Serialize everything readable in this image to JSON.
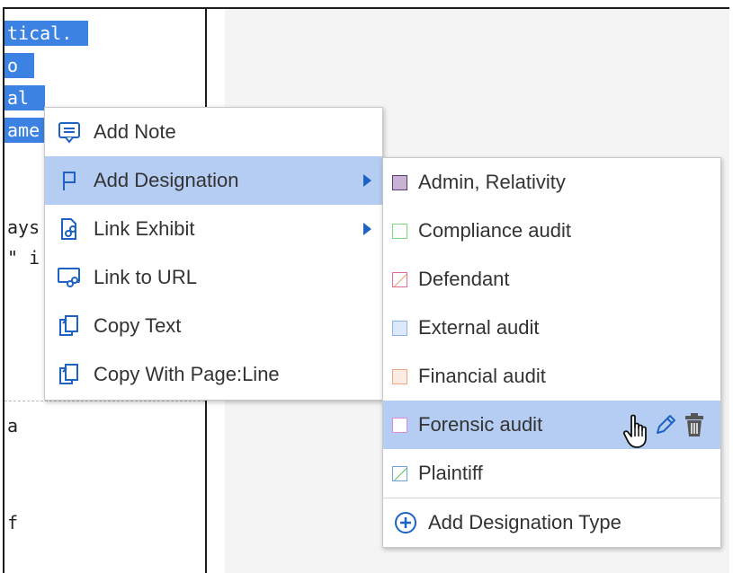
{
  "document": {
    "highlighted_lines": [
      "tical.",
      "o",
      "al",
      "ame"
    ],
    "plain_lines": [
      "ays",
      "\" i",
      "a",
      "f"
    ]
  },
  "context_menu": {
    "items": [
      {
        "label": "Add Note",
        "icon": "note-icon",
        "has_submenu": false,
        "active": false
      },
      {
        "label": "Add Designation",
        "icon": "flag-icon",
        "has_submenu": true,
        "active": true
      },
      {
        "label": "Link Exhibit",
        "icon": "link-exhibit-icon",
        "has_submenu": true,
        "active": false
      },
      {
        "label": "Link to URL",
        "icon": "link-url-icon",
        "has_submenu": false,
        "active": false
      },
      {
        "label": "Copy Text",
        "icon": "copy-icon",
        "has_submenu": false,
        "active": false
      },
      {
        "label": "Copy With Page:Line",
        "icon": "copy-icon",
        "has_submenu": false,
        "active": false
      }
    ]
  },
  "designation_submenu": {
    "items": [
      {
        "label": "Admin, Relativity",
        "swatch_fill": "#c9b3d4",
        "swatch_border": "#5d3a6e",
        "slash": false,
        "active": false
      },
      {
        "label": "Compliance audit",
        "swatch_fill": "#ffffff",
        "swatch_border": "#7ed67e",
        "slash": false,
        "active": false
      },
      {
        "label": "Defendant",
        "swatch_fill": "#ffffff",
        "swatch_border": "#e56a8f",
        "slash": true,
        "slash_color": "#e8a27a",
        "active": false
      },
      {
        "label": "External audit",
        "swatch_fill": "#dbe9fb",
        "swatch_border": "#8fb4e6",
        "slash": false,
        "active": false
      },
      {
        "label": "Financial audit",
        "swatch_fill": "#fdece3",
        "swatch_border": "#f0a57e",
        "slash": false,
        "active": false
      },
      {
        "label": "Forensic audit",
        "swatch_fill": "#ffffff",
        "swatch_border": "#d98ad9",
        "slash": false,
        "active": true
      },
      {
        "label": "Plaintiff",
        "swatch_fill": "#ffffff",
        "swatch_border": "#6da0e0",
        "slash": true,
        "slash_color": "#5cc85c",
        "active": false
      }
    ],
    "add_type_label": "Add Designation Type",
    "row_tools": [
      "edit-pencil-icon",
      "trash-icon"
    ]
  },
  "colors": {
    "accent": "#1e63c4",
    "selection_bg": "#3b82e3",
    "menu_active_bg": "#b5cdf2"
  }
}
